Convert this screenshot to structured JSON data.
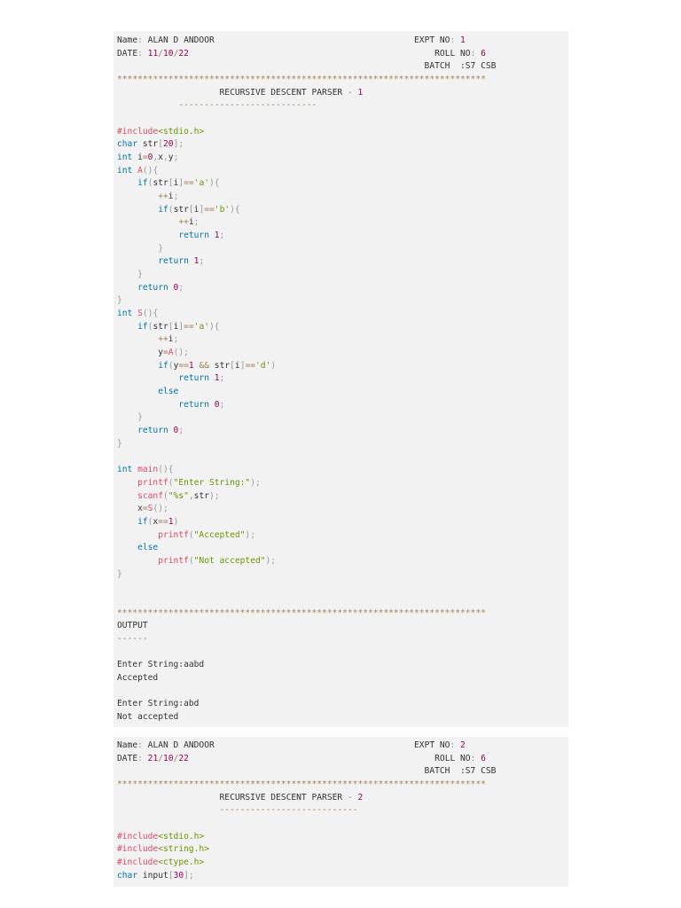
{
  "code_blocks": [
    {
      "lines": [
        [
          [
            "Name",
            "t"
          ],
          [
            ": ",
            "p"
          ],
          [
            "ALAN D ANDOOR                                       EXPT NO",
            "t"
          ],
          [
            ": ",
            "p"
          ],
          [
            "1",
            "n"
          ]
        ],
        [
          [
            "DATE",
            "t"
          ],
          [
            ": ",
            "p"
          ],
          [
            "11",
            "n"
          ],
          [
            "/",
            "o"
          ],
          [
            "10",
            "n"
          ],
          [
            "/",
            "o"
          ],
          [
            "22                                                ",
            "n"
          ],
          [
            "ROLL NO",
            "t"
          ],
          [
            ": ",
            "p"
          ],
          [
            "6",
            "n"
          ]
        ],
        [
          [
            "                                                            BATCH  :S7 CSB",
            "t"
          ]
        ],
        [
          [
            "************************************************************************",
            "o"
          ]
        ],
        [
          [
            "                    RECURSIVE DESCENT PARSER ",
            "t"
          ],
          [
            "- ",
            "o"
          ],
          [
            "1",
            "n"
          ]
        ],
        [
          [
            "            ",
            "t"
          ],
          [
            "---------------------------",
            "o"
          ]
        ],
        [
          [
            "",
            "t"
          ]
        ],
        [
          [
            "#include",
            "f"
          ],
          [
            "<stdio.h>",
            "s"
          ]
        ],
        [
          [
            "char",
            "k"
          ],
          [
            " str",
            "t"
          ],
          [
            "[",
            "p"
          ],
          [
            "20",
            "n"
          ],
          [
            "];",
            "p"
          ]
        ],
        [
          [
            "int",
            "k"
          ],
          [
            " i",
            "t"
          ],
          [
            "=",
            "o"
          ],
          [
            "0",
            "n"
          ],
          [
            ",",
            "p"
          ],
          [
            "x",
            "t"
          ],
          [
            ",",
            "p"
          ],
          [
            "y",
            "t"
          ],
          [
            ";",
            "p"
          ]
        ],
        [
          [
            "int",
            "k"
          ],
          [
            " A",
            "f"
          ],
          [
            "(){",
            "p"
          ]
        ],
        [
          [
            "    ",
            "t"
          ],
          [
            "if",
            "k"
          ],
          [
            "(",
            "p"
          ],
          [
            "str",
            "t"
          ],
          [
            "[",
            "p"
          ],
          [
            "i",
            "t"
          ],
          [
            "]",
            "p"
          ],
          [
            "==",
            "o"
          ],
          [
            "'a'",
            "s"
          ],
          [
            "){",
            "p"
          ]
        ],
        [
          [
            "        ",
            "t"
          ],
          [
            "++",
            "o"
          ],
          [
            "i",
            "t"
          ],
          [
            ";",
            "p"
          ]
        ],
        [
          [
            "        ",
            "t"
          ],
          [
            "if",
            "k"
          ],
          [
            "(",
            "p"
          ],
          [
            "str",
            "t"
          ],
          [
            "[",
            "p"
          ],
          [
            "i",
            "t"
          ],
          [
            "]",
            "p"
          ],
          [
            "==",
            "o"
          ],
          [
            "'b'",
            "s"
          ],
          [
            "){",
            "p"
          ]
        ],
        [
          [
            "            ",
            "t"
          ],
          [
            "++",
            "o"
          ],
          [
            "i",
            "t"
          ],
          [
            ";",
            "p"
          ]
        ],
        [
          [
            "            ",
            "t"
          ],
          [
            "return",
            "k"
          ],
          [
            " 1",
            "n"
          ],
          [
            ";",
            "p"
          ]
        ],
        [
          [
            "        ",
            "t"
          ],
          [
            "}",
            "p"
          ]
        ],
        [
          [
            "        ",
            "t"
          ],
          [
            "return",
            "k"
          ],
          [
            " 1",
            "n"
          ],
          [
            ";",
            "p"
          ]
        ],
        [
          [
            "    ",
            "t"
          ],
          [
            "}",
            "p"
          ]
        ],
        [
          [
            "    ",
            "t"
          ],
          [
            "return",
            "k"
          ],
          [
            " 0",
            "n"
          ],
          [
            ";",
            "p"
          ]
        ],
        [
          [
            "}",
            "p"
          ]
        ],
        [
          [
            "int",
            "k"
          ],
          [
            " S",
            "f"
          ],
          [
            "(){",
            "p"
          ]
        ],
        [
          [
            "    ",
            "t"
          ],
          [
            "if",
            "k"
          ],
          [
            "(",
            "p"
          ],
          [
            "str",
            "t"
          ],
          [
            "[",
            "p"
          ],
          [
            "i",
            "t"
          ],
          [
            "]",
            "p"
          ],
          [
            "==",
            "o"
          ],
          [
            "'a'",
            "s"
          ],
          [
            "){",
            "p"
          ]
        ],
        [
          [
            "        ",
            "t"
          ],
          [
            "++",
            "o"
          ],
          [
            "i",
            "t"
          ],
          [
            ";",
            "p"
          ]
        ],
        [
          [
            "        ",
            "t"
          ],
          [
            "y",
            "t"
          ],
          [
            "=",
            "o"
          ],
          [
            "A",
            "f"
          ],
          [
            "();",
            "p"
          ]
        ],
        [
          [
            "        ",
            "t"
          ],
          [
            "if",
            "k"
          ],
          [
            "(",
            "p"
          ],
          [
            "y",
            "t"
          ],
          [
            "==",
            "o"
          ],
          [
            "1",
            "n"
          ],
          [
            " && ",
            "o"
          ],
          [
            "str",
            "t"
          ],
          [
            "[",
            "p"
          ],
          [
            "i",
            "t"
          ],
          [
            "]",
            "p"
          ],
          [
            "==",
            "o"
          ],
          [
            "'d'",
            "s"
          ],
          [
            ")",
            "p"
          ]
        ],
        [
          [
            "            ",
            "t"
          ],
          [
            "return",
            "k"
          ],
          [
            " 1",
            "n"
          ],
          [
            ";",
            "p"
          ]
        ],
        [
          [
            "        ",
            "t"
          ],
          [
            "else",
            "k"
          ]
        ],
        [
          [
            "            ",
            "t"
          ],
          [
            "return",
            "k"
          ],
          [
            " 0",
            "n"
          ],
          [
            ";",
            "p"
          ]
        ],
        [
          [
            "    ",
            "t"
          ],
          [
            "}",
            "p"
          ]
        ],
        [
          [
            "    ",
            "t"
          ],
          [
            "return",
            "k"
          ],
          [
            " 0",
            "n"
          ],
          [
            ";",
            "p"
          ]
        ],
        [
          [
            "}",
            "p"
          ]
        ],
        [
          [
            "",
            "t"
          ]
        ],
        [
          [
            "int",
            "k"
          ],
          [
            " main",
            "f"
          ],
          [
            "(){",
            "p"
          ]
        ],
        [
          [
            "    ",
            "t"
          ],
          [
            "printf",
            "f"
          ],
          [
            "(",
            "p"
          ],
          [
            "\"Enter String:\"",
            "s"
          ],
          [
            ");",
            "p"
          ]
        ],
        [
          [
            "    ",
            "t"
          ],
          [
            "scanf",
            "f"
          ],
          [
            "(",
            "p"
          ],
          [
            "\"%s\"",
            "s"
          ],
          [
            ",",
            "p"
          ],
          [
            "str",
            "t"
          ],
          [
            ");",
            "p"
          ]
        ],
        [
          [
            "    ",
            "t"
          ],
          [
            "x",
            "t"
          ],
          [
            "=",
            "o"
          ],
          [
            "S",
            "f"
          ],
          [
            "();",
            "p"
          ]
        ],
        [
          [
            "    ",
            "t"
          ],
          [
            "if",
            "k"
          ],
          [
            "(",
            "p"
          ],
          [
            "x",
            "t"
          ],
          [
            "==",
            "o"
          ],
          [
            "1",
            "n"
          ],
          [
            ")",
            "p"
          ]
        ],
        [
          [
            "        ",
            "t"
          ],
          [
            "printf",
            "f"
          ],
          [
            "(",
            "p"
          ],
          [
            "\"Accepted\"",
            "s"
          ],
          [
            ");",
            "p"
          ]
        ],
        [
          [
            "    ",
            "t"
          ],
          [
            "else",
            "k"
          ]
        ],
        [
          [
            "        ",
            "t"
          ],
          [
            "printf",
            "f"
          ],
          [
            "(",
            "p"
          ],
          [
            "\"Not accepted\"",
            "s"
          ],
          [
            ");",
            "p"
          ]
        ],
        [
          [
            "}",
            "p"
          ]
        ],
        [
          [
            "",
            "t"
          ]
        ],
        [
          [
            "",
            "t"
          ]
        ],
        [
          [
            "************************************************************************",
            "o"
          ]
        ],
        [
          [
            "OUTPUT",
            "t"
          ]
        ],
        [
          [
            "------",
            "o"
          ]
        ],
        [
          [
            "",
            "t"
          ]
        ],
        [
          [
            "Enter String:aabd",
            "t"
          ]
        ],
        [
          [
            "Accepted",
            "t"
          ]
        ],
        [
          [
            "",
            "t"
          ]
        ],
        [
          [
            "Enter String:abd",
            "t"
          ]
        ],
        [
          [
            "Not accepted",
            "t"
          ]
        ]
      ]
    },
    {
      "lines": [
        [
          [
            "Name",
            "t"
          ],
          [
            ": ",
            "p"
          ],
          [
            "ALAN D ANDOOR                                       EXPT NO",
            "t"
          ],
          [
            ": ",
            "p"
          ],
          [
            "2",
            "n"
          ]
        ],
        [
          [
            "DATE",
            "t"
          ],
          [
            ": ",
            "p"
          ],
          [
            "21",
            "n"
          ],
          [
            "/",
            "o"
          ],
          [
            "10",
            "n"
          ],
          [
            "/",
            "o"
          ],
          [
            "22                                                ",
            "n"
          ],
          [
            "ROLL NO",
            "t"
          ],
          [
            ": ",
            "p"
          ],
          [
            "6",
            "n"
          ]
        ],
        [
          [
            "                                                            BATCH  :S7 CSB",
            "t"
          ]
        ],
        [
          [
            "************************************************************************",
            "o"
          ]
        ],
        [
          [
            "                    RECURSIVE DESCENT PARSER ",
            "t"
          ],
          [
            "- ",
            "o"
          ],
          [
            "2",
            "n"
          ]
        ],
        [
          [
            "                    ",
            "t"
          ],
          [
            "---------------------------",
            "o"
          ]
        ],
        [
          [
            "",
            "t"
          ]
        ],
        [
          [
            "#include",
            "f"
          ],
          [
            "<stdio.h>",
            "s"
          ]
        ],
        [
          [
            "#include",
            "f"
          ],
          [
            "<string.h>",
            "s"
          ]
        ],
        [
          [
            "#include",
            "f"
          ],
          [
            "<ctype.h>",
            "s"
          ]
        ],
        [
          [
            "char",
            "k"
          ],
          [
            " input",
            "t"
          ],
          [
            "[",
            "p"
          ],
          [
            "30",
            "n"
          ],
          [
            "];",
            "p"
          ]
        ]
      ]
    }
  ]
}
